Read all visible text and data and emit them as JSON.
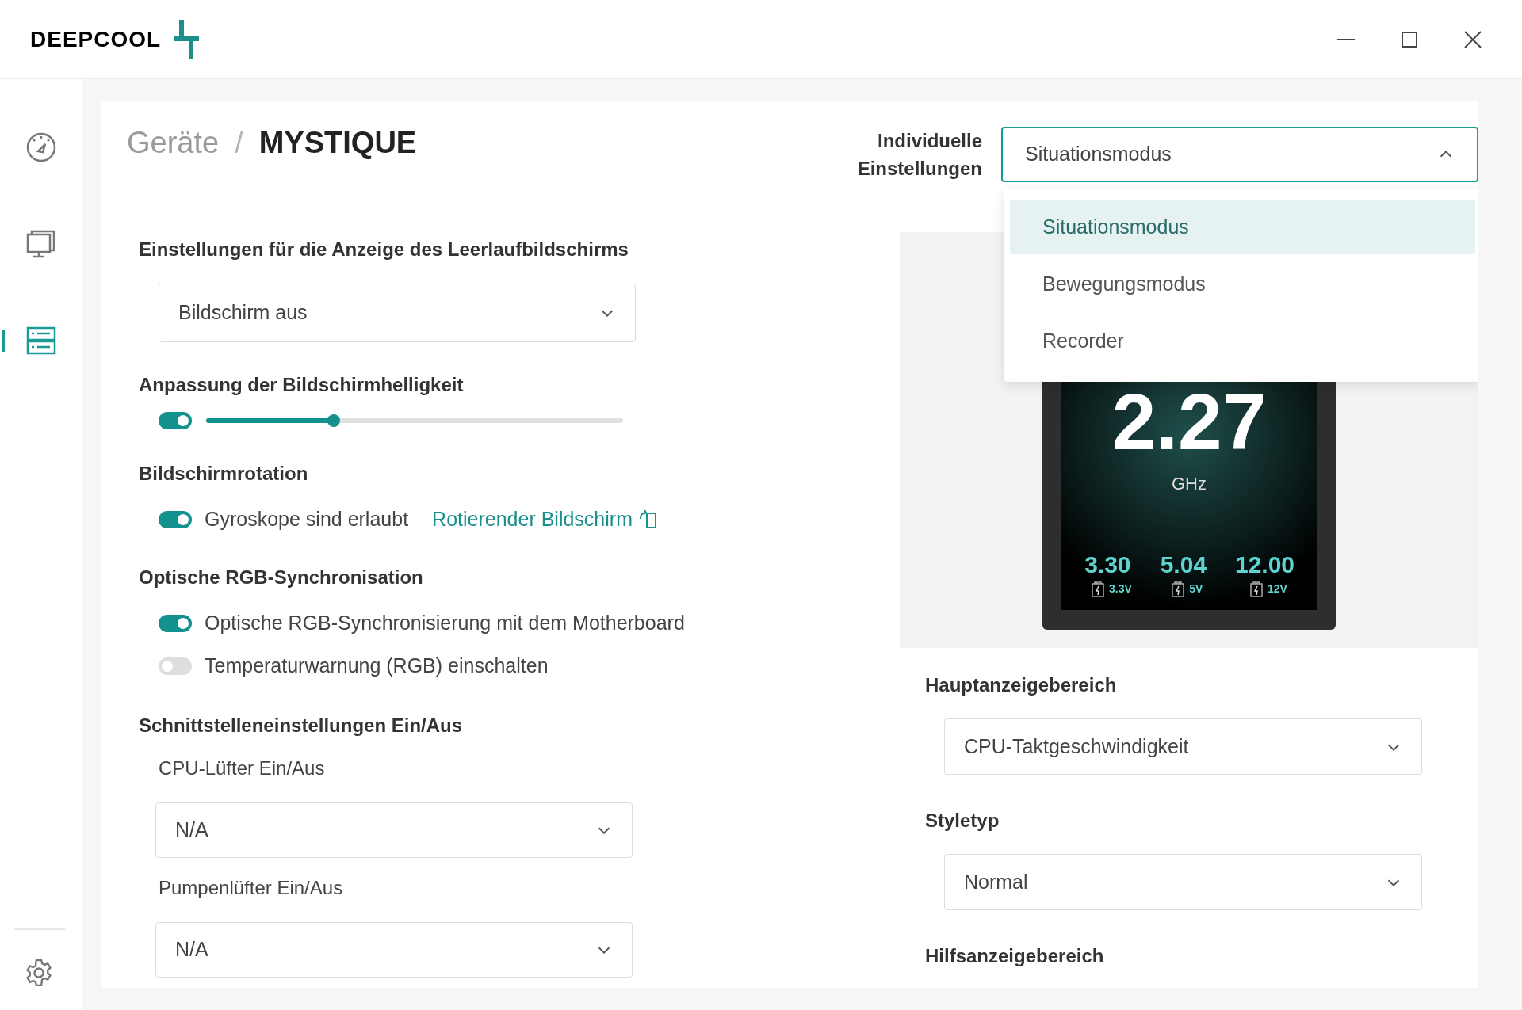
{
  "header": {
    "logo": "DEEPCOOL"
  },
  "sidebar": {
    "items": [
      {
        "kind": "gauge",
        "selected": false
      },
      {
        "kind": "monitor",
        "selected": false
      },
      {
        "kind": "device",
        "selected": true
      }
    ]
  },
  "breadcrumb": {
    "parent": "Geräte",
    "separator": "/",
    "current": "MYSTIQUE"
  },
  "profile": {
    "label": "Individuelle Einstellungen",
    "value": "Situationsmodus",
    "expanded": true,
    "options": [
      {
        "label": "Situationsmodus",
        "selected": true
      },
      {
        "label": "Bewegungsmodus",
        "selected": false
      },
      {
        "label": "Recorder",
        "selected": false
      }
    ]
  },
  "idle_display": {
    "heading": "Einstellungen für die Anzeige des Leerlaufbildschirms",
    "value": "Bildschirm aus"
  },
  "brightness": {
    "heading": "Anpassung der Bildschirmhelligkeit",
    "on": true,
    "level": 0.3
  },
  "rotation": {
    "heading": "Bildschirmrotation",
    "toggle": {
      "label": "Gyroskope sind erlaubt",
      "on": true
    },
    "link": "Rotierender Bildschirm"
  },
  "rgb_sync": {
    "heading": "Optische RGB-Synchronisation",
    "toggles": [
      {
        "label": "Optische RGB-Synchronisierung mit dem Motherboard",
        "on": true
      },
      {
        "label": "Temperaturwarnung (RGB) einschalten",
        "on": false
      }
    ]
  },
  "interfaces": {
    "heading": "Schnittstelleneinstellungen Ein/Aus",
    "fields": [
      {
        "label": "CPU-Lüfter Ein/Aus",
        "value": "N/A"
      },
      {
        "label": "Pumpenlüfter Ein/Aus",
        "value": "N/A"
      }
    ]
  },
  "preview": {
    "value": "2.27",
    "unit": "GHz",
    "readings": [
      {
        "value": "3.30",
        "label": "3.3V"
      },
      {
        "value": "5.04",
        "label": "5V"
      },
      {
        "value": "12.00",
        "label": "12V"
      }
    ]
  },
  "display_fields": [
    {
      "heading": "Hauptanzeigebereich",
      "value": "CPU-Taktgeschwindigkeit"
    },
    {
      "heading": "Styletyp",
      "value": "Normal"
    },
    {
      "heading": "Hilfsanzeigebereich"
    }
  ]
}
